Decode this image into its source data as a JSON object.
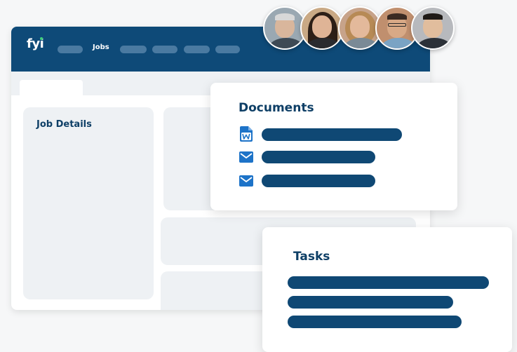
{
  "app": {
    "logo": "fyi",
    "nav_active": "Jobs",
    "job_details_title": "Job Details"
  },
  "documents_card": {
    "title": "Documents",
    "items": [
      {
        "icon": "word-document-icon"
      },
      {
        "icon": "email-icon"
      },
      {
        "icon": "email-icon"
      }
    ]
  },
  "tasks_card": {
    "title": "Tasks"
  },
  "avatars": [
    {
      "icon": "person-older-man-avatar"
    },
    {
      "icon": "person-woman-dark-hair-avatar"
    },
    {
      "icon": "person-woman-blonde-avatar"
    },
    {
      "icon": "person-man-glasses-avatar"
    },
    {
      "icon": "person-man-suit-avatar"
    }
  ],
  "colors": {
    "brand_navy": "#0e4a78",
    "text_navy": "#0e3f66",
    "bar_navy": "#0f4874",
    "icon_blue": "#1d73c8",
    "logo_dot": "#3fd17a"
  }
}
